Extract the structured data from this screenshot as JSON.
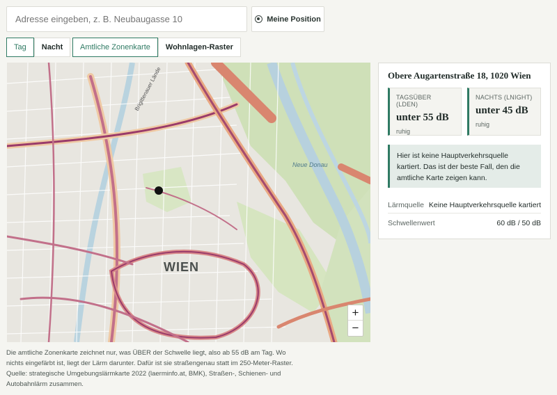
{
  "search": {
    "placeholder": "Adresse eingeben, z. B. Neubaugasse 10"
  },
  "position_button": {
    "label": "Meine Position",
    "icon": "location-target-icon"
  },
  "time_toggle": {
    "options": [
      "Tag",
      "Nacht"
    ],
    "selected": "Tag"
  },
  "map_toggle": {
    "options": [
      "Amtliche Zonenkarte",
      "Wohnlagen-Raster"
    ],
    "selected": "Amtliche Zonenkarte"
  },
  "map": {
    "city_label": "WIEN",
    "river_label": "Neue Donau",
    "street_label": "Brigittenauer Lände",
    "zoom_in": "+",
    "zoom_out": "−"
  },
  "panel": {
    "address": "Obere Augartenstraße 18, 1020 Wien",
    "day": {
      "label": "TAGSÜBER (LDEN)",
      "value": "unter 55 dB",
      "rating": "ruhig"
    },
    "night": {
      "label": "NACHTS (LNIGHT)",
      "value": "unter 45 dB",
      "rating": "ruhig"
    },
    "note": "Hier ist keine Hauptverkehrsquelle kartiert. Das ist der beste Fall, den die amtliche Karte zeigen kann.",
    "rows": [
      {
        "key": "Lärmquelle",
        "value": "Keine Hauptverkehrsquelle kartiert"
      },
      {
        "key": "Schwellenwert",
        "value": "60 dB / 50 dB"
      }
    ]
  },
  "footer": {
    "line1": "Die amtliche Zonenkarte zeichnet nur, was ÜBER der Schwelle liegt, also ab 55 dB am Tag. Wo",
    "line2": "nichts eingefärbt ist, liegt der Lärm darunter. Dafür ist sie straßengenau statt im 250-Meter-Raster.",
    "line3": "Quelle: strategische Umgebungslärmkarte 2022 (laerminfo.at, BMK), Straßen-, Schienen- und",
    "line4": "Autobahnlärm zusammen."
  },
  "colors": {
    "accent": "#2f7a63",
    "noise_high": "#9a3b6a",
    "noise_mid": "#d9866f",
    "noise_low": "#efc9a4",
    "park": "#c9ddb0"
  }
}
